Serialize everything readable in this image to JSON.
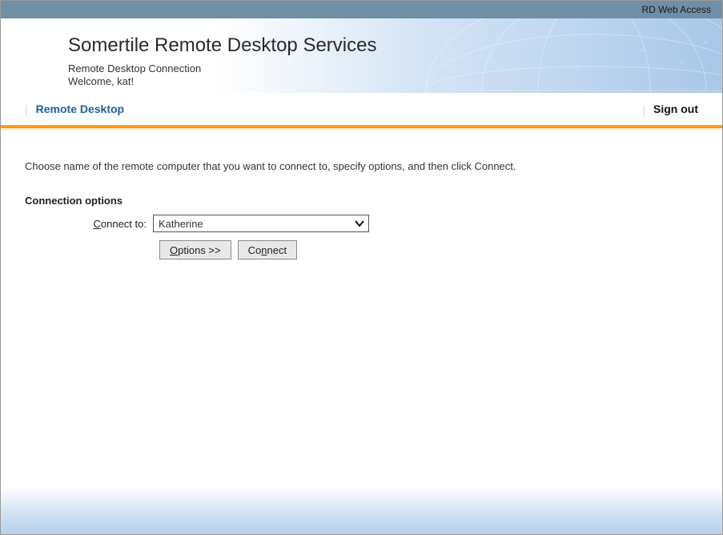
{
  "topbar": {
    "label": "RD Web Access"
  },
  "banner": {
    "title": "Somertile Remote Desktop Services",
    "subtitle": "Remote Desktop Connection",
    "welcome": "Welcome, kat!"
  },
  "nav": {
    "tab": "Remote Desktop",
    "signout": "Sign out"
  },
  "content": {
    "intro": "Choose name of the remote computer that you want to connect to, specify options, and then click Connect.",
    "section_head": "Connection options",
    "connect_label_pre": "C",
    "connect_label_post": "onnect to:",
    "connect_value": "Katherine",
    "options_btn_pre": "O",
    "options_btn_post": "ptions >>",
    "connect_btn_pre": "Co",
    "connect_btn_mid": "n",
    "connect_btn_post": "nect"
  }
}
